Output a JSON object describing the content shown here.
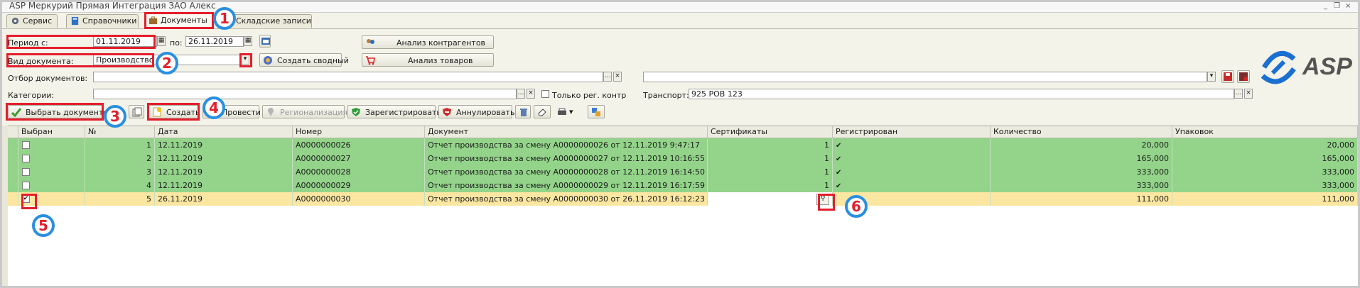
{
  "window": {
    "title": "ASP Меркурий Прямая Интеграция ЗАО Алекс",
    "controls": [
      "_",
      "❐",
      "×"
    ]
  },
  "tabs": [
    {
      "label": "Сервис",
      "icon": "gear-icon"
    },
    {
      "label": "Справочники",
      "icon": "book-icon"
    },
    {
      "label": "Документы",
      "icon": "briefcase-icon",
      "active": true
    },
    {
      "label": "Складские записи",
      "icon": "warehouse-icon"
    }
  ],
  "filters": {
    "period_label": "Период с:",
    "period_from": "01.11.2019",
    "period_to_label": "по:",
    "period_to": "26.11.2019",
    "doctype_label": "Вид документа:",
    "doctype_value": "Производство",
    "create_summary_label": "Создать сводный",
    "analyze_counterparties_label": "Анализ контрагентов",
    "analyze_goods_label": "Анализ товаров",
    "selection_label": "Отбор документов:",
    "categories_label": "Категории:",
    "only_reg_label": "Только рег. контр",
    "transport_label": "Транспорт:",
    "transport_value": "925 РОВ 123",
    "logo_text": "ASP"
  },
  "toolbar": {
    "select_docs": "Выбрать документы",
    "create": "Создать",
    "post": "Провести",
    "regionalization": "Регионализация",
    "register": "Зарегистрировать",
    "cancel": "Аннулировать"
  },
  "table": {
    "columns": [
      "Выбран",
      "№",
      "Дата",
      "Номер",
      "Документ",
      "Сертификаты",
      "Регистрирован",
      "Количество",
      "Упаковок"
    ],
    "rows": [
      {
        "checked": false,
        "n": "1",
        "date": "12.11.2019",
        "number": "А0000000026",
        "doc": "Отчет производства за смену А0000000026 от 12.11.2019 9:47:17",
        "certs": "1",
        "registered": true,
        "qty": "20,000",
        "packs": "20,000",
        "status": "done"
      },
      {
        "checked": false,
        "n": "2",
        "date": "12.11.2019",
        "number": "А0000000027",
        "doc": "Отчет производства за смену А0000000027 от 12.11.2019 10:16:55",
        "certs": "1",
        "registered": true,
        "qty": "165,000",
        "packs": "165,000",
        "status": "done"
      },
      {
        "checked": false,
        "n": "3",
        "date": "12.11.2019",
        "number": "А0000000028",
        "doc": "Отчет производства за смену А0000000028 от 12.11.2019 16:14:50",
        "certs": "1",
        "registered": true,
        "qty": "333,000",
        "packs": "333,000",
        "status": "done"
      },
      {
        "checked": false,
        "n": "4",
        "date": "12.11.2019",
        "number": "А0000000029",
        "doc": "Отчет производства за смену А0000000029 от 12.11.2019 16:17:59",
        "certs": "1",
        "registered": true,
        "qty": "333,000",
        "packs": "333,000",
        "status": "done"
      },
      {
        "checked": true,
        "n": "5",
        "date": "26.11.2019",
        "number": "А0000000030",
        "doc": "Отчет производства за смену А0000000030 от 26.11.2019 16:12:23",
        "certs": "",
        "registered": false,
        "qty": "111,000",
        "packs": "111,000",
        "status": "new"
      }
    ]
  },
  "annotations": [
    "1",
    "2",
    "3",
    "4",
    "5",
    "6"
  ],
  "colors": {
    "row_done": "#93d48a",
    "row_new": "#fbe7a1",
    "annotation_box": "#e41e2b",
    "annotation_circle": "#2b8fe0"
  }
}
